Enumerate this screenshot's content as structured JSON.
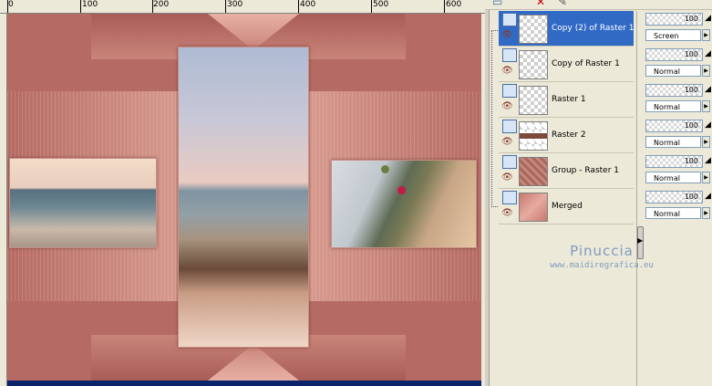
{
  "ruler": {
    "ticks": [
      "0",
      "100",
      "200",
      "300",
      "400",
      "500",
      "600"
    ]
  },
  "toolbar": {
    "icons": [
      "new-layer-icon",
      "delete-layer-icon",
      "properties-icon"
    ]
  },
  "layers": [
    {
      "name": "Copy (2) of Raster 1",
      "selected": true,
      "thumb": "transparent",
      "opacity": "100",
      "blend": "Screen"
    },
    {
      "name": "Copy of Raster 1",
      "selected": false,
      "thumb": "transparent",
      "opacity": "100",
      "blend": "Normal"
    },
    {
      "name": "Raster 1",
      "selected": false,
      "thumb": "transparent",
      "opacity": "100",
      "blend": "Normal"
    },
    {
      "name": "Raster 2",
      "selected": false,
      "thumb": "raster2",
      "opacity": "100",
      "blend": "Normal"
    },
    {
      "name": "Group - Raster 1",
      "selected": false,
      "thumb": "group",
      "opacity": "100",
      "blend": "Normal"
    },
    {
      "name": "Merged",
      "selected": false,
      "thumb": "merged",
      "opacity": "100",
      "blend": "Normal"
    }
  ],
  "watermark": {
    "name": "Pinuccia",
    "site": "www.maidiregrafica.eu"
  },
  "colors": {
    "canvas": "#b56b63",
    "selection": "#316ac5",
    "watermark": "#7d9cc0"
  }
}
